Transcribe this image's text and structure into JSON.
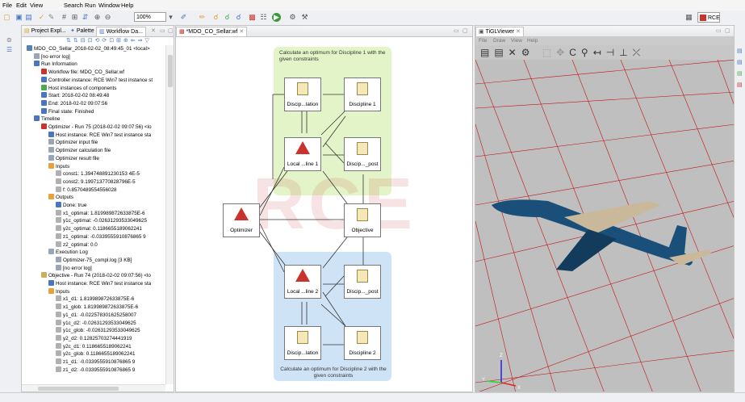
{
  "menu": [
    "File",
    "Edit",
    "View",
    "Search",
    "Run",
    "Window",
    "Help"
  ],
  "toolbar": {
    "zoom": "100%",
    "perspective": "RCE"
  },
  "left_panel": {
    "tabs": [
      "Project Expl...",
      "Palette",
      "Workflow Da..."
    ],
    "tree": [
      {
        "text": "MDO_CO_Sellar_2018-02-02_08:49:45_01 <local>",
        "indent": 0,
        "color": "#5a7fb8"
      },
      {
        "text": "[no error log]",
        "indent": 1,
        "color": "#9aa6b8"
      },
      {
        "text": "Run Information",
        "indent": 1,
        "color": "#4a76c0"
      },
      {
        "text": "Workflow file: MDO_CO_Sellar.wf",
        "indent": 2,
        "color": "#c8332d"
      },
      {
        "text": "Controller instance: RCE Win7 test instance st",
        "indent": 2,
        "color": "#4a76c0"
      },
      {
        "text": "Host instances of components",
        "indent": 2,
        "color": "#4caa4c"
      },
      {
        "text": "Start: 2018-02-02 08:49:48",
        "indent": 2,
        "color": "#4a76c0"
      },
      {
        "text": "End: 2018-02-02 09:07:56",
        "indent": 2,
        "color": "#4a76c0"
      },
      {
        "text": "Final state: Finished",
        "indent": 2,
        "color": "#4a76c0"
      },
      {
        "text": "Timeline",
        "indent": 1,
        "color": "#4a76c0"
      },
      {
        "text": "Optimizer - Run 75 (2018-02-02 09:07:56) <lo",
        "indent": 2,
        "color": "#c8332d"
      },
      {
        "text": "Host instance: RCE Win7 test instance sta",
        "indent": 3,
        "color": "#4a76c0"
      },
      {
        "text": "Optimizer input file",
        "indent": 3,
        "color": "#9aa6b8"
      },
      {
        "text": "Optimizer calculation file",
        "indent": 3,
        "color": "#9aa6b8"
      },
      {
        "text": "Optimizer result file",
        "indent": 3,
        "color": "#9aa6b8"
      },
      {
        "text": "Inputs",
        "indent": 3,
        "color": "#e8a23c"
      },
      {
        "text": "const1: 1.394748891230153 4E-5",
        "indent": 4,
        "color": "#b0b0b0"
      },
      {
        "text": "const2: 9.199713770828796E-5",
        "indent": 4,
        "color": "#b0b0b0"
      },
      {
        "text": "f: 0.8570489554556028",
        "indent": 4,
        "color": "#b0b0b0"
      },
      {
        "text": "Outputs",
        "indent": 3,
        "color": "#e8a23c"
      },
      {
        "text": "Done: true",
        "indent": 4,
        "color": "#4a76c0"
      },
      {
        "text": "x1_optimal: 1.819989872633875E-6",
        "indent": 4,
        "color": "#b0b0b0"
      },
      {
        "text": "y1c_optimal: -0.02631293533049625",
        "indent": 4,
        "color": "#b0b0b0"
      },
      {
        "text": "y2c_optimal: 0.1186655189062241",
        "indent": 4,
        "color": "#b0b0b0"
      },
      {
        "text": "z1_optimal: -0.0339555910876865 9",
        "indent": 4,
        "color": "#b0b0b0"
      },
      {
        "text": "z2_optimal: 0.0",
        "indent": 4,
        "color": "#b0b0b0"
      },
      {
        "text": "Execution Log",
        "indent": 3,
        "color": "#9aa6b8"
      },
      {
        "text": "Optimizer-75_compl.log [3 KB]",
        "indent": 4,
        "color": "#9aa6b8"
      },
      {
        "text": "[no error log]",
        "indent": 4,
        "color": "#9aa6b8"
      },
      {
        "text": "Objective - Run 74 (2018-02-02 09:07:56) <lo",
        "indent": 2,
        "color": "#c8b060"
      },
      {
        "text": "Host instance: RCE Win7 test instance sta",
        "indent": 3,
        "color": "#4a76c0"
      },
      {
        "text": "Inputs",
        "indent": 3,
        "color": "#e8a23c"
      },
      {
        "text": "x1_d1: 1.819989872633875E-6",
        "indent": 4,
        "color": "#b0b0b0"
      },
      {
        "text": "x1_glob: 1.819989872633875E-6",
        "indent": 4,
        "color": "#b0b0b0"
      },
      {
        "text": "y1_d1: -0.022578301625258007",
        "indent": 4,
        "color": "#b0b0b0"
      },
      {
        "text": "y1c_d2: -0.02631293533049625",
        "indent": 4,
        "color": "#b0b0b0"
      },
      {
        "text": "y1c_glob: -0.02631293533049625",
        "indent": 4,
        "color": "#b0b0b0"
      },
      {
        "text": "y2_d2: 0.12825703274441919",
        "indent": 4,
        "color": "#b0b0b0"
      },
      {
        "text": "y2c_d1: 0.1186655189062241",
        "indent": 4,
        "color": "#b0b0b0"
      },
      {
        "text": "y2c_glob: 0.1186655189062241",
        "indent": 4,
        "color": "#b0b0b0"
      },
      {
        "text": "z1_d1: -0.0339555910876865 9",
        "indent": 4,
        "color": "#b0b0b0"
      },
      {
        "text": "z1_d2: -0.0339555910876865 9",
        "indent": 4,
        "color": "#b0b0b0"
      }
    ]
  },
  "editor": {
    "tab": "*MDO_CO_Sellar.wf",
    "group1_caption": "Calculate an optimum for Discipline 1 with the given constraints",
    "group2_caption": "Calculate an optimum for Discipline 2 with the given constraints",
    "watermark": "RCE",
    "nodes": {
      "disc_top_left": "Discip...lation",
      "disc1": "Discipline 1",
      "local1": "Local ...line 1",
      "disc_post1": "Discip..._post",
      "optimizer": "Optimizer",
      "objective": "Objective",
      "local2": "Local ...line 2",
      "disc_post2": "Discip..._post",
      "disc_bottom_left": "Discip...lation",
      "disc2": "Discipline 2"
    }
  },
  "viewer": {
    "tab": "TiGLViewer",
    "menu": [
      "File",
      "Draw",
      "View",
      "Help"
    ],
    "axes": {
      "x": "X",
      "y": "Y",
      "z": "Z"
    }
  },
  "colors": {
    "green_group": "#e3f5c8",
    "blue_group": "#cfe3f7",
    "aircraft": "#1a4f7a",
    "wing_beige": "#c9b99a"
  }
}
